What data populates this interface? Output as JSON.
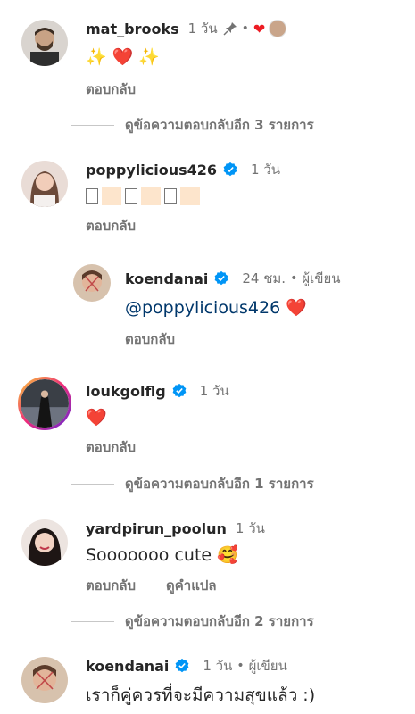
{
  "comments": [
    {
      "user": "mat_brooks",
      "time": "1 วัน",
      "text": "✨ ❤️ ✨",
      "reply": "ตอบกลับ"
    },
    {
      "user": "poppylicious426",
      "time": "1 วัน",
      "reply": "ตอบกลับ"
    },
    {
      "user": "koendanai",
      "time": "24 ชม.",
      "author": "ผู้เขียน",
      "mention": "@poppylicious426",
      "reply": "ตอบกลับ"
    },
    {
      "user": "loukgolflg",
      "time": "1 วัน",
      "text": "❤️",
      "reply": "ตอบกลับ"
    },
    {
      "user": "yardpirun_poolun",
      "time": "1 วัน",
      "text": "Sooooooo cute 🥰",
      "reply": "ตอบกลับ",
      "translate": "ดูคำแปล"
    },
    {
      "user": "koendanai",
      "time": "1 วัน",
      "author": "ผู้เขียน",
      "text": "เราก็คู่ควรที่จะมีความสุขแล้ว :)"
    }
  ],
  "view_replies": [
    "ดูข้อความตอบกลับอีก 3 รายการ",
    "ดูข้อความตอบกลับอีก 1 รายการ",
    "ดูข้อความตอบกลับอีก 2 รายการ"
  ],
  "colors": {
    "verified": "#0095f6",
    "heart": "#ed1c24",
    "mention": "#00376b",
    "muted": "#737373"
  },
  "icons": [
    "pin-icon",
    "verified-badge-icon",
    "heart-icon"
  ]
}
